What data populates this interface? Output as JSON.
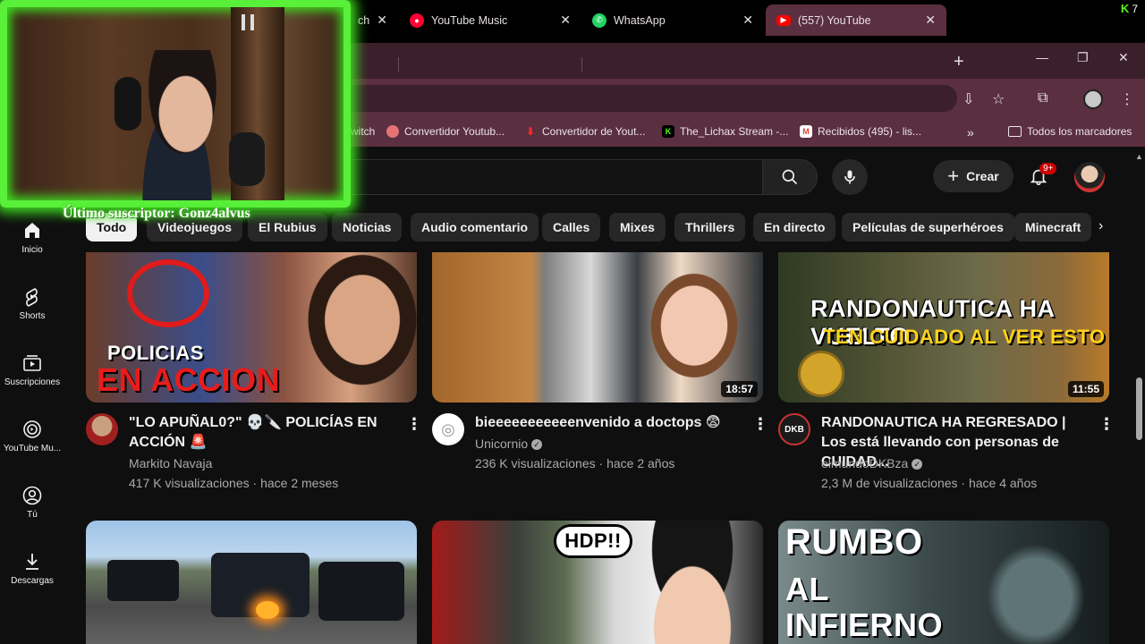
{
  "kick_counter": "7",
  "browser": {
    "tabs": [
      {
        "label": "ch",
        "favicon": "twitch-icon"
      },
      {
        "label": "YouTube Music",
        "favicon": "youtube-music-icon"
      },
      {
        "label": "WhatsApp",
        "favicon": "whatsapp-icon"
      },
      {
        "label": "(557) YouTube",
        "favicon": "youtube-icon",
        "active": true
      }
    ],
    "bookmarks": [
      {
        "label": "witch"
      },
      {
        "label": "Convertidor Youtub..."
      },
      {
        "label": "Convertidor de Yout..."
      },
      {
        "label": "The_Lichax Stream -..."
      },
      {
        "label": "Recibidos (495) - lis..."
      }
    ],
    "all_bookmarks_label": "Todos los marcadores"
  },
  "youtube": {
    "create_label": "Crear",
    "notif_badge": "9+",
    "chips": [
      "Todo",
      "Videojuegos",
      "El Rubius",
      "Noticias",
      "Audio comentario",
      "Calles",
      "Mixes",
      "Thrillers",
      "En directo",
      "Películas de superhéroes",
      "Minecraft"
    ],
    "sidebar": [
      {
        "label": "Inicio",
        "icon": "home-icon"
      },
      {
        "label": "Shorts",
        "icon": "shorts-icon"
      },
      {
        "label": "Suscripciones",
        "icon": "subscriptions-icon"
      },
      {
        "label": "YouTube Mu...",
        "icon": "youtube-music-icon"
      },
      {
        "label": "Tú",
        "icon": "user-icon"
      },
      {
        "label": "Descargas",
        "icon": "download-icon"
      }
    ],
    "videos": [
      {
        "title": "\"LO APUÑAL0?\" 💀🔪 POLICÍAS EN ACCIÓN 🚨",
        "channel": "Markito Navaja",
        "verified": false,
        "meta": "417 K visualizaciones · hace 2 meses",
        "duration": "",
        "thumb_text": [
          "POLICIAS",
          "EN ACCION"
        ]
      },
      {
        "title": "bieeeeeeeeeeenvenido a doctops 😨",
        "channel": "Unicornio",
        "verified": true,
        "meta": "236 K visualizaciones · hace 2 años",
        "duration": "18:57",
        "thumb_text": []
      },
      {
        "title": "RANDONAUTICA HA REGRESADO | Los está llevando con personas de CUIDAD...",
        "channel": "elmundoDKBza",
        "verified": true,
        "meta": "2,3 M de visualizaciones · hace 4 años",
        "duration": "11:55",
        "thumb_text": [
          "RANDONAUTICA HA VUELTO",
          "TEN CUIDADO AL VER ESTO"
        ]
      }
    ],
    "row2_thumb_text": {
      "hdp": "HDP!!",
      "rumbo": [
        "RUMBO",
        "AL",
        "INFIERNO"
      ]
    }
  },
  "stream_overlay": {
    "subscriber_text": "Último suscriptor: Gonz4alvus"
  }
}
